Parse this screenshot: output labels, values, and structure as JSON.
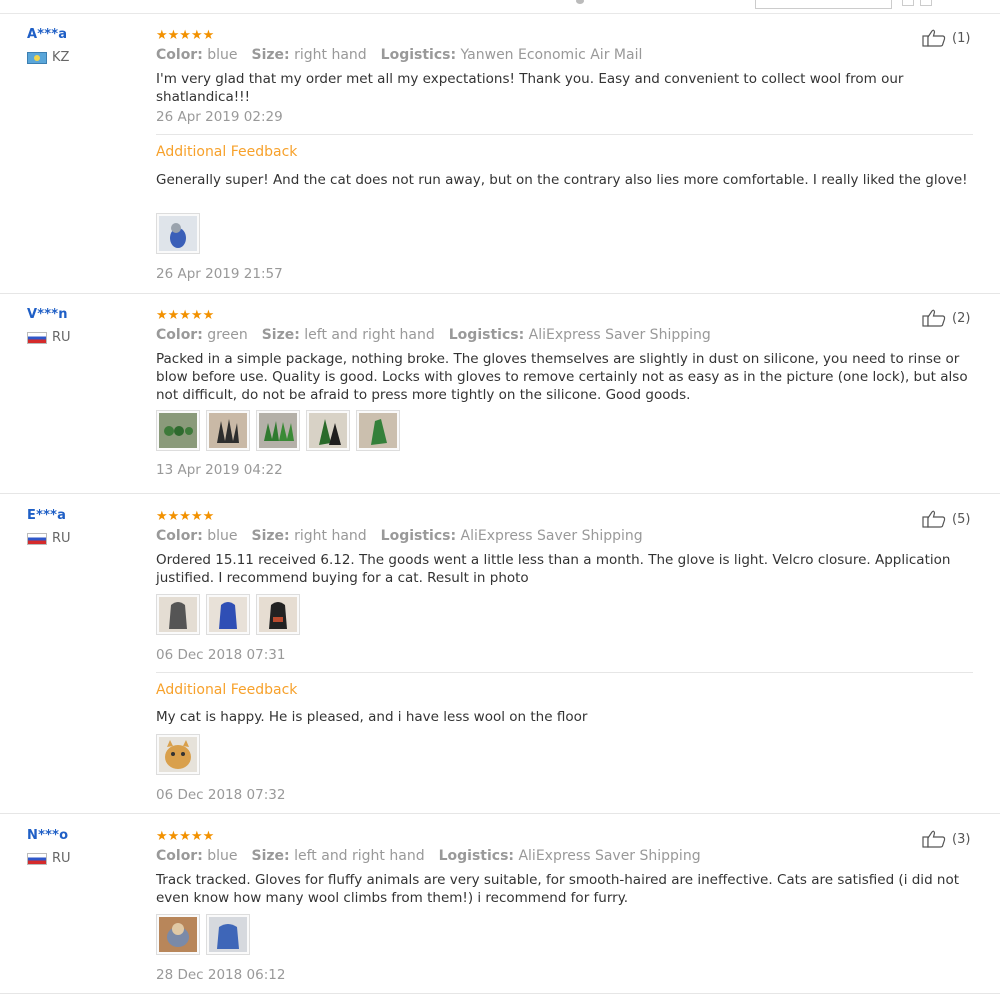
{
  "reviews": [
    {
      "user": "A***a",
      "country": "KZ",
      "stars": "★★★★★",
      "likes": "(1)",
      "color_label": "Color:",
      "color": "blue",
      "size_label": "Size:",
      "size": "right hand",
      "logistics_label": "Logistics:",
      "logistics": "Yanwen Economic Air Mail",
      "text": "I'm very glad that my order met all my expectations! Thank you. Easy and convenient to collect wool from our shatlandica!!!",
      "date": "26 Apr 2019 02:29",
      "additional": {
        "label": "Additional Feedback",
        "text": "Generally super! And the cat does not run away, but on the contrary also lies more comfortable. I really liked the glove!",
        "date": "26 Apr 2019 21:57"
      }
    },
    {
      "user": "V***n",
      "country": "RU",
      "stars": "★★★★★",
      "likes": "(2)",
      "color_label": "Color:",
      "color": "green",
      "size_label": "Size:",
      "size": "left and right hand",
      "logistics_label": "Logistics:",
      "logistics": "AliExpress Saver Shipping",
      "text": "Packed in a simple package, nothing broke. The gloves themselves are slightly in dust on silicone, you need to rinse or blow before use. Quality is good. Locks with gloves to remove certainly not as easy as in the picture (one lock), but also not difficult, do not be afraid to press more tightly on the silicone. Good goods.",
      "date": "13 Apr 2019 04:22"
    },
    {
      "user": "E***a",
      "country": "RU",
      "stars": "★★★★★",
      "likes": "(5)",
      "color_label": "Color:",
      "color": "blue",
      "size_label": "Size:",
      "size": "right hand",
      "logistics_label": "Logistics:",
      "logistics": "AliExpress Saver Shipping",
      "text": "Ordered 15.11 received 6.12. The goods went a little less than a month. The glove is light. Velcro closure. Application justified. I recommend buying for a cat. Result in photo",
      "date": "06 Dec 2018 07:31",
      "additional": {
        "label": "Additional Feedback",
        "text": "My cat is happy. He is pleased, and i have less wool on the floor",
        "date": "06 Dec 2018 07:32"
      }
    },
    {
      "user": "N***o",
      "country": "RU",
      "stars": "★★★★★",
      "likes": "(3)",
      "color_label": "Color:",
      "color": "blue",
      "size_label": "Size:",
      "size": "left and right hand",
      "logistics_label": "Logistics:",
      "logistics": "AliExpress Saver Shipping",
      "text": "Track tracked. Gloves for fluffy animals are very suitable, for smooth-haired are ineffective. Cats are satisfied (i did not even know how many wool climbs from them!) i recommend for furry.",
      "date": "28 Dec 2018 06:12"
    }
  ],
  "colors": {
    "username": "#1f5fc6",
    "stars": "#f29100",
    "additional": "#f7a12b",
    "muted": "#999999"
  },
  "icons": {
    "like": "thumbs-up-icon",
    "photo": "review-photo-thumbnail"
  }
}
